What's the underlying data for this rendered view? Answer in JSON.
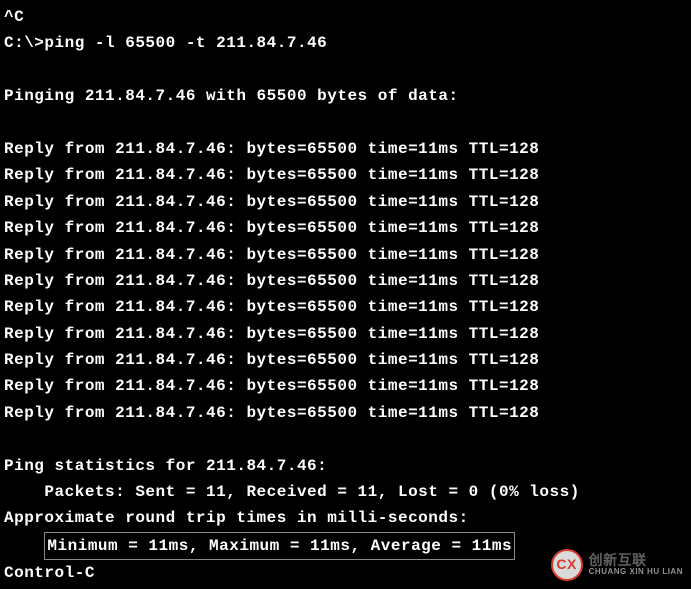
{
  "terminal": {
    "interrupt": "^C",
    "prompt": "C:\\>ping -l 65500 -t 211.84.7.46",
    "pinging_header": "Pinging 211.84.7.46 with 65500 bytes of data:",
    "replies": [
      "Reply from 211.84.7.46: bytes=65500 time=11ms TTL=128",
      "Reply from 211.84.7.46: bytes=65500 time=11ms TTL=128",
      "Reply from 211.84.7.46: bytes=65500 time=11ms TTL=128",
      "Reply from 211.84.7.46: bytes=65500 time=11ms TTL=128",
      "Reply from 211.84.7.46: bytes=65500 time=11ms TTL=128",
      "Reply from 211.84.7.46: bytes=65500 time=11ms TTL=128",
      "Reply from 211.84.7.46: bytes=65500 time=11ms TTL=128",
      "Reply from 211.84.7.46: bytes=65500 time=11ms TTL=128",
      "Reply from 211.84.7.46: bytes=65500 time=11ms TTL=128",
      "Reply from 211.84.7.46: bytes=65500 time=11ms TTL=128",
      "Reply from 211.84.7.46: bytes=65500 time=11ms TTL=128"
    ],
    "stats_header": "Ping statistics for 211.84.7.46:",
    "packets_line": "    Packets: Sent = 11, Received = 11, Lost = 0 (0% loss)",
    "approx_line": "Approximate round trip times in milli-seconds:",
    "minmax_prefix": "    ",
    "minmax_line": "Minimum = 11ms, Maximum = 11ms, Average = 11ms",
    "control_c": "Control-C"
  },
  "watermark": {
    "icon_text": "CX",
    "cn": "创新互联",
    "en": "CHUANG XIN HU LIAN"
  }
}
